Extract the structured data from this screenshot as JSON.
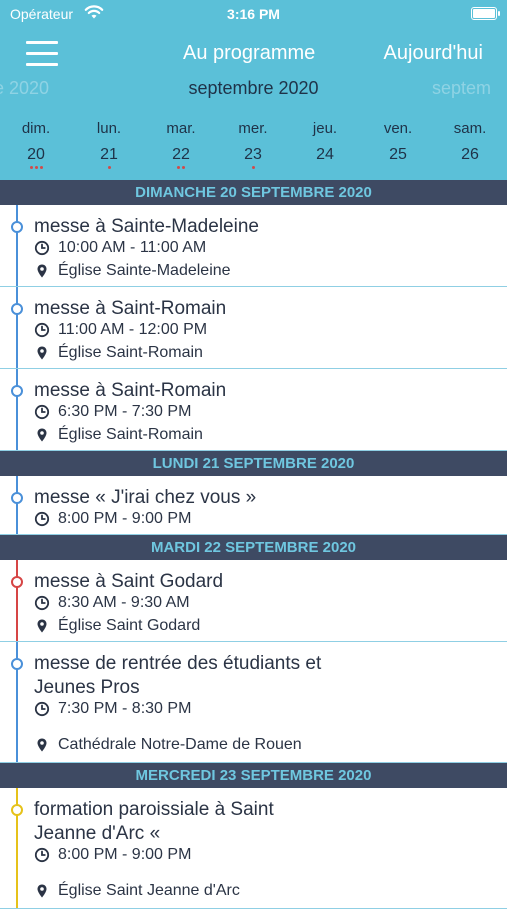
{
  "status_bar": {
    "carrier": "Opérateur",
    "time": "3:16 PM"
  },
  "nav": {
    "title": "Au programme",
    "today": "Aujourd'hui"
  },
  "calendar": {
    "prev_month": "re 2020",
    "current_month": "septembre 2020",
    "next_month": "septem",
    "days": [
      {
        "name": "dim.",
        "num": "20",
        "dots": 3
      },
      {
        "name": "lun.",
        "num": "21",
        "dots": 1
      },
      {
        "name": "mar.",
        "num": "22",
        "dots": 2
      },
      {
        "name": "mer.",
        "num": "23",
        "dots": 1
      },
      {
        "name": "jeu.",
        "num": "24",
        "dots": 0
      },
      {
        "name": "ven.",
        "num": "25",
        "dots": 0
      },
      {
        "name": "sam.",
        "num": "26",
        "dots": 0
      }
    ]
  },
  "sections": [
    {
      "header": "DIMANCHE 20 SEPTEMBRE 2020",
      "events": [
        {
          "title": "messe à Sainte-Madeleine",
          "time": "10:00 AM - 11:00 AM",
          "place": "Église Sainte-Madeleine",
          "color": "#4a90d9"
        },
        {
          "title": "messe à Saint-Romain",
          "time": "11:00 AM - 12:00 PM",
          "place": "Église Saint-Romain",
          "color": "#4a90d9"
        },
        {
          "title": "messe à Saint-Romain",
          "time": "6:30 PM - 7:30 PM",
          "place": "Église Saint-Romain",
          "color": "#4a90d9"
        }
      ]
    },
    {
      "header": "LUNDI 21 SEPTEMBRE 2020",
      "events": [
        {
          "title": "messe « J'irai chez vous »",
          "time": "8:00 PM - 9:00 PM",
          "place": "",
          "color": "#4a90d9"
        }
      ]
    },
    {
      "header": "MARDI 22 SEPTEMBRE 2020",
      "events": [
        {
          "title": "messe à Saint Godard",
          "time": "8:30 AM - 9:30 AM",
          "place": "Église Saint Godard",
          "color": "#d64545"
        },
        {
          "title": "messe de rentrée des étudiants et\nJeunes Pros",
          "time": "7:30 PM - 8:30 PM",
          "place": "Cathédrale Notre-Dame de Rouen",
          "color": "#4a90d9"
        }
      ]
    },
    {
      "header": "MERCREDI 23 SEPTEMBRE 2020",
      "events": [
        {
          "title": "formation paroissiale à Saint\nJeanne d'Arc «",
          "time": "8:00 PM - 9:00 PM",
          "place": "Église Saint Jeanne d'Arc",
          "color": "#e6c21a"
        }
      ]
    }
  ]
}
